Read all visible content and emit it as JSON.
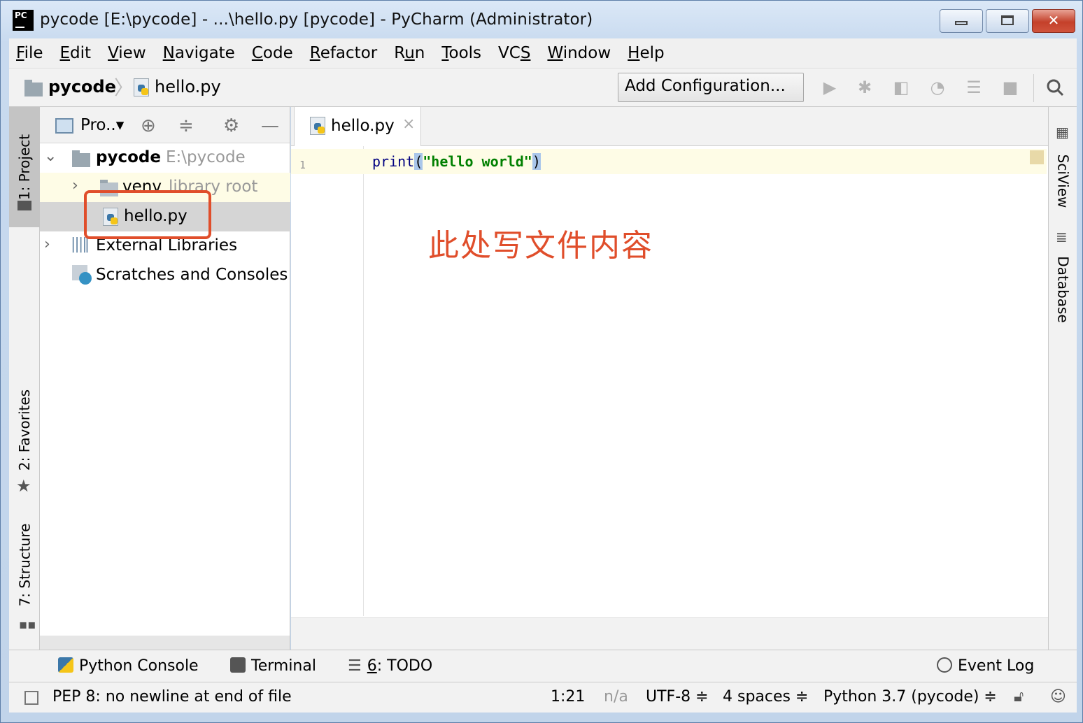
{
  "window": {
    "logo_text": "PC",
    "title": "pycode [E:\\pycode] - ...\\hello.py [pycode] - PyCharm (Administrator)",
    "close_glyph": "✕"
  },
  "menu": [
    {
      "u": "F",
      "rest": "ile"
    },
    {
      "u": "E",
      "rest": "dit"
    },
    {
      "u": "V",
      "rest": "iew"
    },
    {
      "u": "N",
      "rest": "avigate"
    },
    {
      "u": "C",
      "rest": "ode"
    },
    {
      "u": "R",
      "rest": "efactor"
    },
    {
      "pre": "R",
      "u": "u",
      "rest": "n"
    },
    {
      "u": "T",
      "rest": "ools"
    },
    {
      "pre": "VC",
      "u": "S",
      "rest": ""
    },
    {
      "u": "W",
      "rest": "indow"
    },
    {
      "u": "H",
      "rest": "elp"
    }
  ],
  "navbar": {
    "project": "pycode",
    "separator": "〉",
    "file": "hello.py",
    "add_configuration": "Add Configuration...",
    "icons": [
      "run-icon",
      "debug-icon",
      "coverage-icon",
      "profile-icon",
      "concurrency-icon",
      "stop-icon",
      "search-icon"
    ]
  },
  "left_strip": {
    "project_tab": "1: Project",
    "favorites_tab": "2: Favorites",
    "structure_tab": "7: Structure"
  },
  "project_panel": {
    "header": "Pro..▾",
    "root_name": "pycode",
    "root_path": "E:\\pycode",
    "venv_name": "venv",
    "venv_note": "library root",
    "file": "hello.py",
    "external": "External Libraries",
    "scratches": "Scratches and Consoles"
  },
  "editor": {
    "tab": "hello.py",
    "tab_close": "×",
    "line_number": "1",
    "code_fn": "print",
    "code_open": "(",
    "code_str": "\"hello world\"",
    "code_close": ")",
    "annotation": "此处写文件内容"
  },
  "right_strip": {
    "sciview": "SciView",
    "database": "Database"
  },
  "toolwindows": {
    "python_console": "Python Console",
    "terminal": "Terminal",
    "todo_num": "6",
    "todo_rest": ": TODO",
    "event_log": "Event Log"
  },
  "status": {
    "message": "PEP 8: no newline at end of file",
    "position": "1:21",
    "na": "n/a",
    "encoding": "UTF-8 ≑",
    "indent": "4 spaces ≑",
    "interpreter": "Python 3.7 (pycode) ≑"
  }
}
